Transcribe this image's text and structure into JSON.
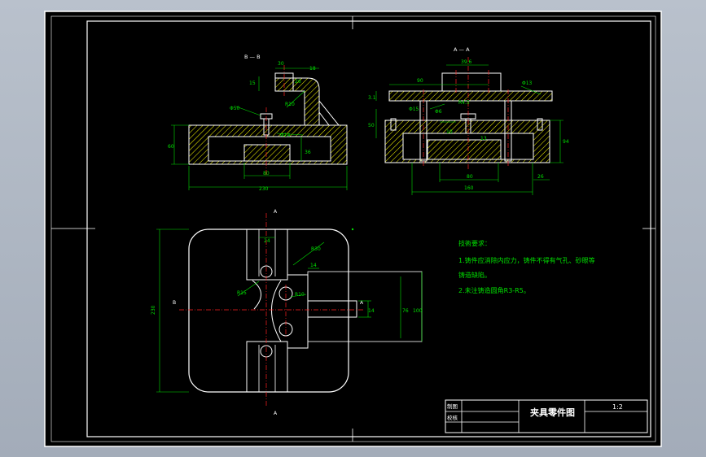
{
  "colors": {
    "viewport_bg": "#aeb6c2",
    "paper": "#000000",
    "frame": "#ffffff",
    "geometry": "#ffffff",
    "dimension": "#00e000",
    "centerline": "#ff2020",
    "hatch": "#ffff00",
    "note_text": "#00e000",
    "title_text": "#ffffff"
  },
  "views": {
    "section_bb_label": "B — B",
    "section_aa_label": "A — A",
    "arrow_a_top": "A",
    "arrow_a_bottom": "A",
    "arrow_b_left": "B",
    "arrow_a_small": "A"
  },
  "dims": {
    "bb_w230": "230",
    "bb_h60": "60",
    "bb_w80": "80",
    "bb_h36": "36",
    "bb_15": "15",
    "bb_phi50": "Φ50",
    "bb_r10": "R10",
    "bb_phi14": "Φ14",
    "bb_18": "18",
    "bb_26": "26",
    "bb_30": "30",
    "aa_w160": "160",
    "aa_w80": "80",
    "aa_26": "26",
    "aa_94": "94",
    "aa_39_6": "39.6",
    "aa_90": "90",
    "aa_phi13": "Φ13",
    "aa_phi6": "Φ6",
    "aa_phi15": "Φ15",
    "aa_3_1": "3.1",
    "aa_50": "50",
    "aa_13": "13",
    "aa_r4_5": "R4.5",
    "aa_10": "10",
    "pv_h230": "230",
    "pv_24": "24",
    "pv_r30": "R30",
    "pv_14a": "14",
    "pv_r15": "R15",
    "pv_r10": "R10",
    "pv_14b": "14",
    "pv_76": "76",
    "pv_100": "100"
  },
  "notes": {
    "title": "技術要求：",
    "line1": "1.铸件应消除内应力，铸件不得有气孔、砂眼等",
    "line1b": "铸造缺陷。",
    "line2": "2.未注铸造圆角R3-R5。"
  },
  "title_block": {
    "drawn_label": "制图",
    "checked_label": "校核",
    "drawing_name": "夹具零件图",
    "scale": "1:2"
  }
}
